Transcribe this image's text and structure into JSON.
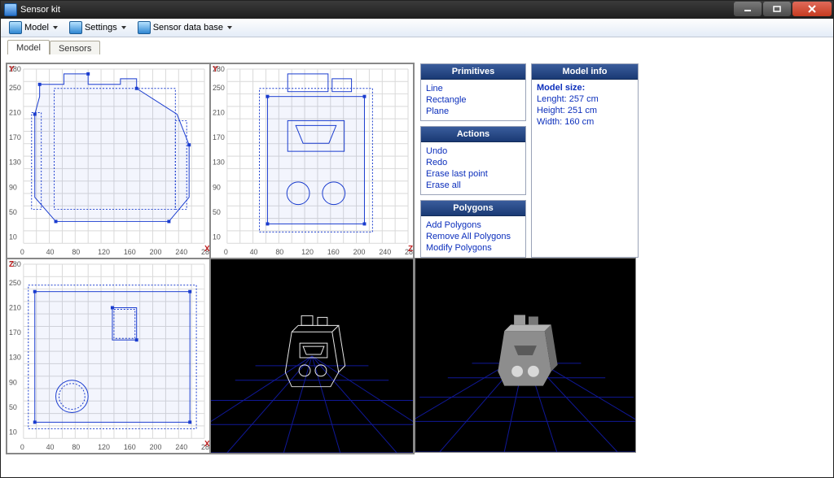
{
  "window": {
    "title": "Sensor kit"
  },
  "menu": {
    "model": "Model",
    "settings": "Settings",
    "database": "Sensor data base"
  },
  "tabs": {
    "model": "Model",
    "sensors": "Sensors"
  },
  "axis": {
    "ticks": [
      "0",
      "10",
      "40",
      "50",
      "80",
      "90",
      "120",
      "130",
      "160",
      "170",
      "200",
      "210",
      "240",
      "250",
      "280"
    ],
    "tl": {
      "h": "X",
      "v": "Y"
    },
    "tr": {
      "h": "Z",
      "v": "Y"
    },
    "bl": {
      "h": "X",
      "v": "Z"
    }
  },
  "panels": {
    "primitives": {
      "title": "Primitives",
      "items": [
        "Line",
        "Rectangle",
        "Plane"
      ]
    },
    "actions": {
      "title": "Actions",
      "items": [
        "Undo",
        "Redo",
        "Erase last point",
        "Erase all"
      ]
    },
    "polygons": {
      "title": "Polygons",
      "items": [
        "Add Polygons",
        "Remove All Polygons",
        "Modify Polygons"
      ]
    }
  },
  "modelinfo": {
    "title": "Model info",
    "heading": "Model size:",
    "length": "Lenght: 257 cm",
    "height": "Height: 251 cm",
    "width": "Width: 160 cm"
  }
}
